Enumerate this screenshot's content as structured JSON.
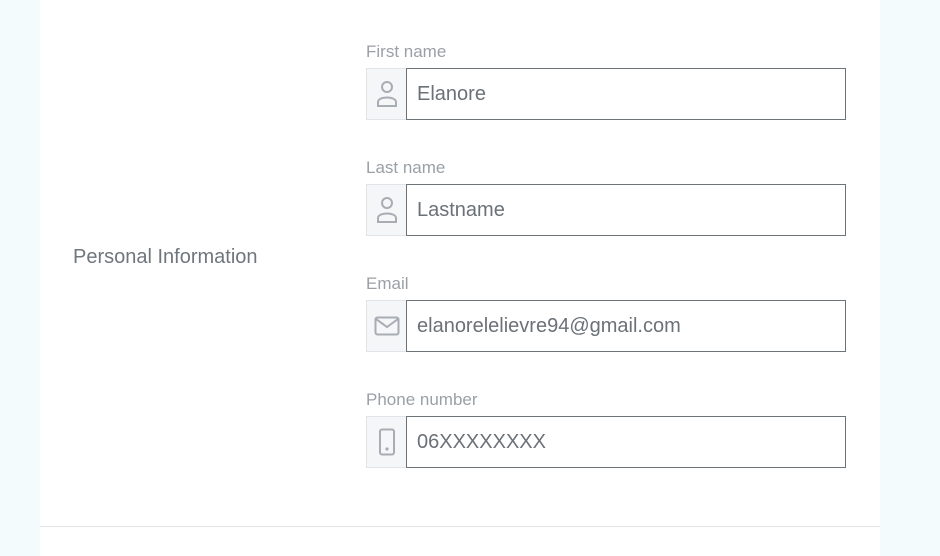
{
  "section": {
    "title": "Personal Information"
  },
  "fields": {
    "first_name": {
      "label": "First name",
      "value": "Elanore",
      "icon": "user-icon"
    },
    "last_name": {
      "label": "Last name",
      "value": "",
      "placeholder": "Lastname",
      "icon": "user-icon"
    },
    "email": {
      "label": "Email",
      "value": "elanorelelievre94@gmail.com",
      "icon": "envelope-icon"
    },
    "phone": {
      "label": "Phone number",
      "value": "",
      "placeholder": "06XXXXXXXX",
      "icon": "mobile-phone-icon"
    }
  },
  "colors": {
    "page_background": "#f4fbfc",
    "card_background": "#ffffff",
    "label_text": "#9aa0a6",
    "input_border": "#6e7378",
    "addon_background": "#f5f6f8"
  }
}
